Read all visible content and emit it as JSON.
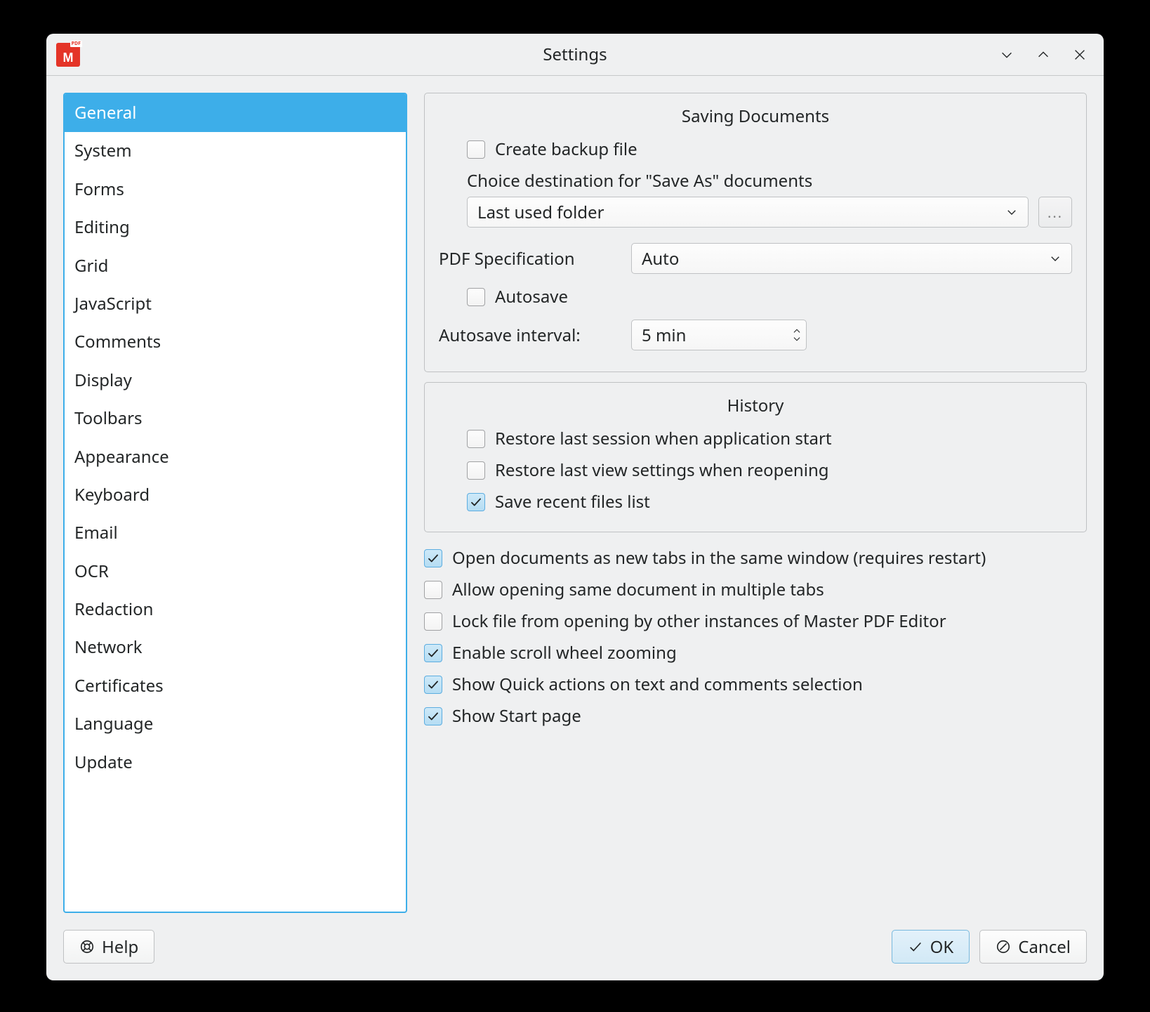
{
  "window": {
    "title": "Settings"
  },
  "sidebar": {
    "items": [
      {
        "label": "General",
        "selected": true
      },
      {
        "label": "System"
      },
      {
        "label": "Forms"
      },
      {
        "label": "Editing"
      },
      {
        "label": "Grid"
      },
      {
        "label": "JavaScript"
      },
      {
        "label": "Comments"
      },
      {
        "label": "Display"
      },
      {
        "label": "Toolbars"
      },
      {
        "label": "Appearance"
      },
      {
        "label": "Keyboard"
      },
      {
        "label": "Email"
      },
      {
        "label": "OCR"
      },
      {
        "label": "Redaction"
      },
      {
        "label": "Network"
      },
      {
        "label": "Certificates"
      },
      {
        "label": "Language"
      },
      {
        "label": "Update"
      }
    ]
  },
  "saving": {
    "title": "Saving Documents",
    "create_backup": {
      "label": "Create backup file",
      "checked": false
    },
    "choice_hint": "Choice destination for \"Save As\" documents",
    "destination": {
      "value": "Last used folder"
    },
    "browse": "...",
    "pdf_spec_label": "PDF Specification",
    "pdf_spec": {
      "value": "Auto"
    },
    "autosave": {
      "label": "Autosave",
      "checked": false
    },
    "autosave_interval_label": "Autosave interval:",
    "autosave_interval": {
      "value": "5 min"
    }
  },
  "history": {
    "title": "History",
    "restore_session": {
      "label": "Restore last session when application start",
      "checked": false
    },
    "restore_view": {
      "label": "Restore last view settings when reopening",
      "checked": false
    },
    "save_recent": {
      "label": "Save recent files list",
      "checked": true
    }
  },
  "options": {
    "new_tabs": {
      "label": "Open documents as new tabs in the same window (requires restart)",
      "checked": true
    },
    "multi_tabs": {
      "label": "Allow opening same document in multiple tabs",
      "checked": false
    },
    "lock_file": {
      "label": "Lock file from opening by other instances of Master PDF Editor",
      "checked": false
    },
    "scroll_zoom": {
      "label": "Enable scroll wheel zooming",
      "checked": true
    },
    "quick_actions": {
      "label": "Show Quick actions on text and comments selection",
      "checked": true
    },
    "start_page": {
      "label": "Show Start page",
      "checked": true
    }
  },
  "footer": {
    "help": "Help",
    "ok": "OK",
    "cancel": "Cancel"
  }
}
